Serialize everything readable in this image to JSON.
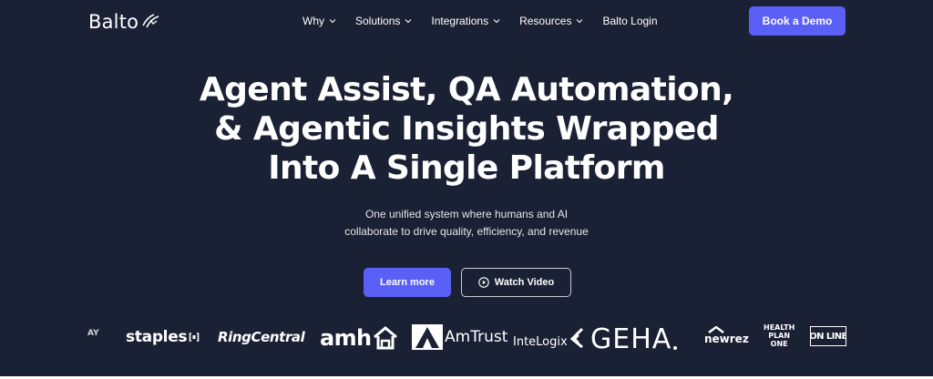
{
  "header": {
    "logo_text": "Balto",
    "nav": [
      {
        "label": "Why",
        "has_dropdown": true
      },
      {
        "label": "Solutions",
        "has_dropdown": true
      },
      {
        "label": "Integrations",
        "has_dropdown": true
      },
      {
        "label": "Resources",
        "has_dropdown": true
      },
      {
        "label": "Balto Login",
        "has_dropdown": false
      }
    ],
    "cta_label": "Book a Demo"
  },
  "hero": {
    "title_lines": [
      "Agent Assist, QA Automation,",
      "& Agentic Insights Wrapped",
      "Into A Single Platform"
    ],
    "subtitle_lines": [
      "One unified system where humans and AI",
      "collaborate to drive quality, efficiency, and revenue"
    ],
    "primary_button": "Learn more",
    "secondary_button": "Watch Video",
    "secondary_icon": "play-circle-icon"
  },
  "customer_logos": {
    "items": [
      {
        "name": "partial",
        "text": "AY"
      },
      {
        "name": "staples",
        "text": "staples"
      },
      {
        "name": "ringcentral",
        "text": "RingCentral"
      },
      {
        "name": "amh",
        "text": "amh"
      },
      {
        "name": "amtrust",
        "text": "AmTrust"
      },
      {
        "name": "intelogix",
        "text": "InteLogix"
      },
      {
        "name": "geha",
        "text": "GEHA"
      },
      {
        "name": "newrez",
        "text": "newrez"
      },
      {
        "name": "health-plan-one",
        "text_lines": [
          "HEALTH",
          "PLAN",
          "ONE"
        ]
      },
      {
        "name": "online",
        "text": "ON LINE"
      }
    ]
  },
  "colors": {
    "background": "#1b2134",
    "accent": "#5a5ff5",
    "text": "#ffffff"
  }
}
